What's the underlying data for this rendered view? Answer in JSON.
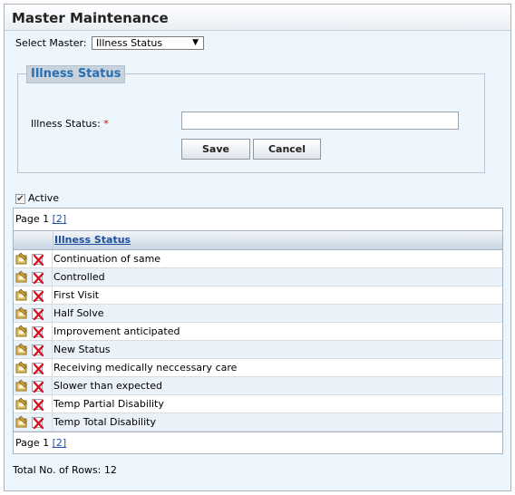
{
  "panel": {
    "title": "Master Maintenance"
  },
  "selector": {
    "label": "Select Master:",
    "value": "Illness Status"
  },
  "form": {
    "legend": "Illness Status",
    "field_label": "Illness Status:",
    "required_mark": "*",
    "field_value": "",
    "save_label": "Save",
    "cancel_label": "Cancel"
  },
  "active": {
    "label": "Active",
    "checked": true
  },
  "pager": {
    "page_text": "Page 1",
    "link_open": "[",
    "link_page": "2",
    "link_close": "]"
  },
  "grid": {
    "column_header": "Illness Status",
    "rows": [
      "Continuation of same",
      "Controlled",
      "First Visit",
      "Half Solve",
      "Improvement anticipated",
      "New Status",
      "Receiving medically neccessary care",
      "Slower than expected",
      "Temp Partial Disability",
      "Temp Total Disability"
    ]
  },
  "footer": {
    "total_text": "Total No. of Rows: 12"
  }
}
